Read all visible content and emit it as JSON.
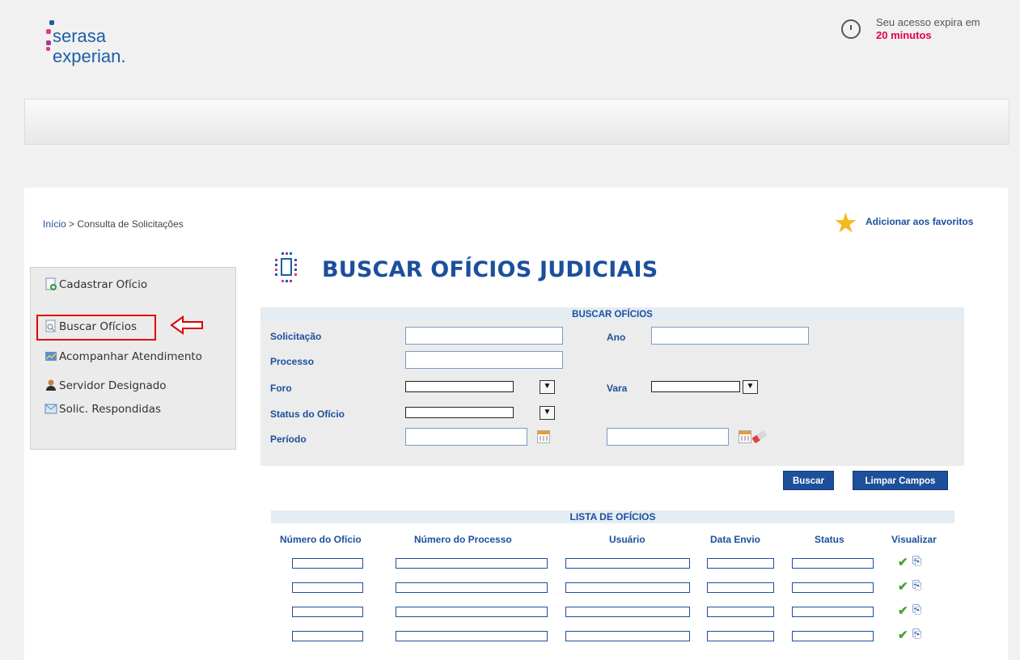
{
  "brand": {
    "line1": "serasa",
    "line2": "experian."
  },
  "session": {
    "label": "Seu acesso expira em",
    "remaining": "20 minutos"
  },
  "breadcrumb": {
    "home": "Início",
    "separator": " > ",
    "current": "Consulta de Solicitações"
  },
  "favorites": {
    "label": "Adicionar aos favoritos"
  },
  "sidebar": {
    "items": [
      {
        "label": "Cadastrar Ofício",
        "icon": "document-add-icon"
      },
      {
        "label": "Buscar Ofícios",
        "icon": "document-search-icon",
        "selected": true
      },
      {
        "label": "Acompanhar Atendimento",
        "icon": "chart-icon"
      },
      {
        "label": "Servidor Designado",
        "icon": "user-icon"
      },
      {
        "label": "Solic. Respondidas",
        "icon": "mail-icon"
      }
    ]
  },
  "page": {
    "title": "BUSCAR OFÍCIOS JUDICIAIS"
  },
  "search": {
    "header": "BUSCAR OFÍCIOS",
    "solicitacao_label": "Solicitação",
    "ano_label": "Ano",
    "processo_label": "Processo",
    "foro_label": "Foro",
    "vara_label": "Vara",
    "status_label": "Status do Ofício",
    "periodo_label": "Período",
    "select_arrow": "▼",
    "buscar_button": "Buscar",
    "limpar_button": "Limpar Campos"
  },
  "list": {
    "header": "LISTA DE OFÍCIOS",
    "columns": [
      "Número do Ofício",
      "Número do Processo",
      "Usuário",
      "Data Envio",
      "Status",
      "Visualizar"
    ],
    "row_count_visible": 4
  },
  "colors": {
    "accent": "#1c4f9c",
    "alert": "#e2004f",
    "button": "#1d4f9a",
    "highlight": "#e00000"
  }
}
